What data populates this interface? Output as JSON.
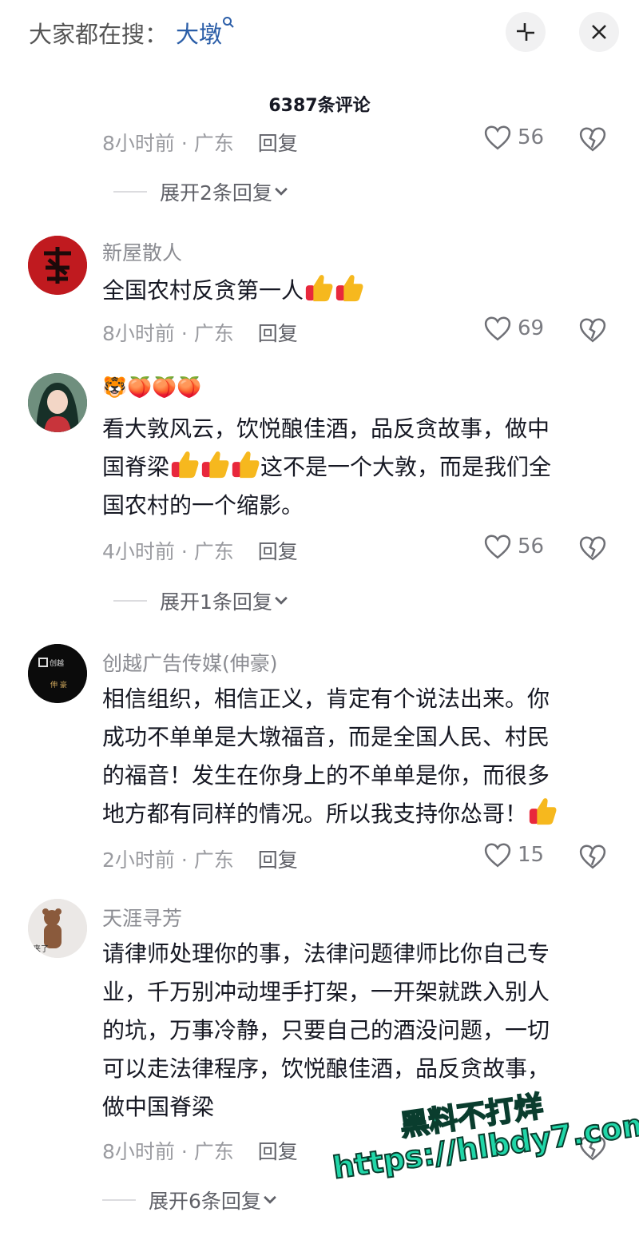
{
  "header": {
    "search_prefix": "大家都在搜：",
    "search_keyword": "大墩",
    "collapse_icon": "collapse-icon",
    "close_icon": "close-icon"
  },
  "title": "6387条评论",
  "comments": [
    {
      "time": "8小时前 · 广东",
      "reply_label": "回复",
      "likes": "56",
      "expand": "展开2条回复"
    },
    {
      "username": "新屋散人",
      "text_prefix": "全国农村反贪第一人",
      "time": "8小时前 · 广东",
      "reply_label": "回复",
      "likes": "69"
    },
    {
      "username": "🐯🍑🍑🍑",
      "line1": "看大敦风云，饮悦酿佳酒，品反贪故事，做中",
      "line2a": "国脊梁",
      "line2b": "这不是一个大敦，而是我们全",
      "line3": "国农村的一个缩影。",
      "time": "4小时前 · 广东",
      "reply_label": "回复",
      "likes": "56",
      "expand": "展开1条回复"
    },
    {
      "username": "创越广告传媒(伸豪)",
      "avatar_text_top": "创越",
      "avatar_text_bottom": "伸 豪",
      "line1": "相信组织，相信正义，肯定有个说法出来。你",
      "line2": "成功不单单是大墩福音，而是全国人民、村民",
      "line3": "的福音！发生在你身上的不单单是你，而很多",
      "line4": "地方都有同样的情况。所以我支持你怂哥！",
      "time": "2小时前 · 广东",
      "reply_label": "回复",
      "likes": "15"
    },
    {
      "username": "天涯寻芳",
      "avatar_text": "来了",
      "line1": "请律师处理你的事，法律问题律师比你自己专",
      "line2": "业，千万别冲动埋手打架，一开架就跌入别人",
      "line3": "的坑，万事冷静，只要自己的酒没问题，一切",
      "line4": "可以走法律程序，饮悦酿佳酒，品反贪故事，",
      "line5": "做中国脊梁",
      "time": "8小时前 · 广东",
      "reply_label": "回复",
      "expand": "展开6条回复"
    }
  ],
  "watermark": {
    "line1": "黑料不打烊",
    "line2": "https://hlbdy7.com"
  },
  "colors": {
    "keyword": "#2b5ea8",
    "watermark": "#20d6a8"
  }
}
